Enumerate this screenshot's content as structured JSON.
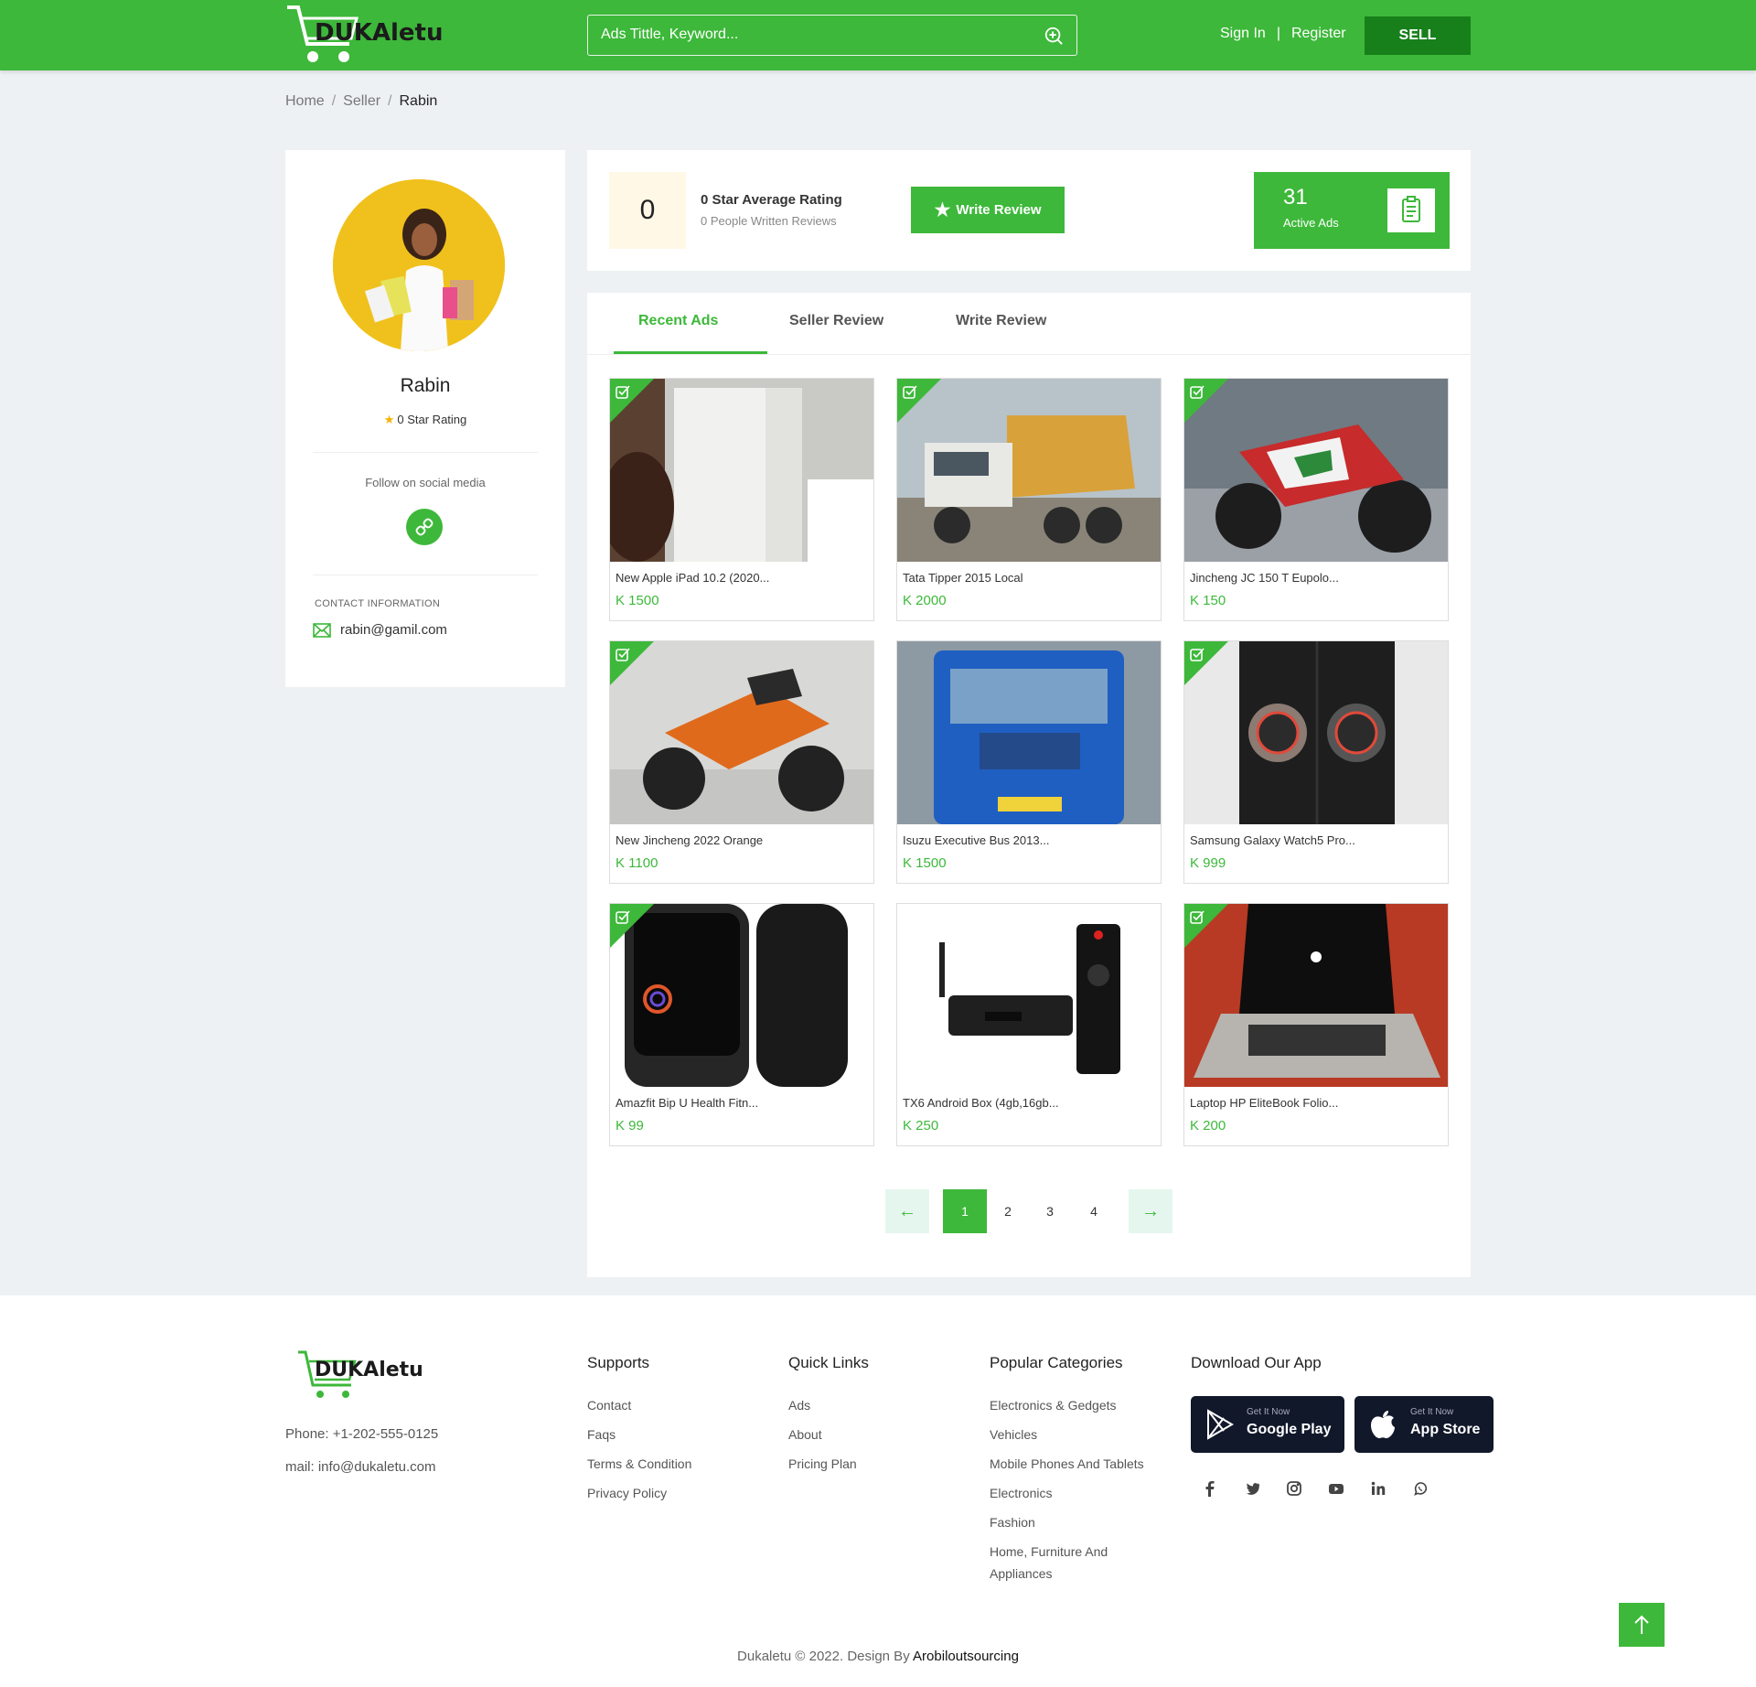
{
  "header": {
    "logo_text": "DUKAletu",
    "search_placeholder": "Ads Tittle, Keyword...",
    "sign_in": "Sign In",
    "separator": "|",
    "register": "Register",
    "sell": "SELL",
    "brand_color": "#3db83a"
  },
  "breadcrumb": {
    "items": [
      "Home",
      "Seller",
      "Rabin"
    ],
    "separator": "/"
  },
  "profile": {
    "name": "Rabin",
    "rating_text": "0 Star Rating",
    "follow_label": "Follow on social media",
    "contact_label": "CONTACT INFORMATION",
    "email": "rabin@gamil.com"
  },
  "stats": {
    "rating_value": "0",
    "rating_title": "0 Star Average Rating",
    "rating_sub": "0 People Written Reviews",
    "write_review": "Write Review",
    "active_count": "31",
    "active_label": "Active Ads"
  },
  "tabs": [
    {
      "label": "Recent Ads",
      "active": true
    },
    {
      "label": "Seller Review",
      "active": false
    },
    {
      "label": "Write Review",
      "active": false
    }
  ],
  "ads": [
    {
      "title": "New Apple iPad 10.2 (2020...",
      "price": "K 1500"
    },
    {
      "title": "Tata Tipper 2015 Local",
      "price": "K 2000"
    },
    {
      "title": "Jincheng JC 150 T Eupolo...",
      "price": "K 150"
    },
    {
      "title": "New Jincheng 2022 Orange",
      "price": "K 1100"
    },
    {
      "title": "Isuzu Executive Bus 2013...",
      "price": "K 1500"
    },
    {
      "title": "Samsung Galaxy Watch5 Pro...",
      "price": "K 999"
    },
    {
      "title": "Amazfit Bip U Health Fitn...",
      "price": "K 99"
    },
    {
      "title": "TX6 Android Box (4gb,16gb...",
      "price": "K 250"
    },
    {
      "title": "Laptop HP EliteBook Folio...",
      "price": "K 200"
    }
  ],
  "pagination": {
    "prev": "←",
    "pages": [
      "1",
      "2",
      "3",
      "4"
    ],
    "current": "1",
    "next": "→"
  },
  "footer": {
    "logo_text": "DUKAletu",
    "phone": "Phone: +1-202-555-0125",
    "mail": "mail: info@dukaletu.com",
    "supports": {
      "title": "Supports",
      "links": [
        "Contact",
        "Faqs",
        "Terms & Condition",
        "Privacy Policy"
      ]
    },
    "quick_links": {
      "title": "Quick Links",
      "links": [
        "Ads",
        "About",
        "Pricing Plan"
      ]
    },
    "categories": {
      "title": "Popular Categories",
      "links": [
        "Electronics & Gedgets",
        "Vehicles",
        "Mobile Phones And Tablets",
        "Electronics",
        "Fashion",
        "Home, Furniture And Appliances"
      ]
    },
    "app": {
      "title": "Download Our App",
      "google_small": "Get It Now",
      "google_big": "Google Play",
      "apple_small": "Get It Now",
      "apple_big": "App Store"
    },
    "copyright_prefix": "Dukaletu © 2022. Design By",
    "copyright_brand": "Arobiloutsourcing"
  }
}
